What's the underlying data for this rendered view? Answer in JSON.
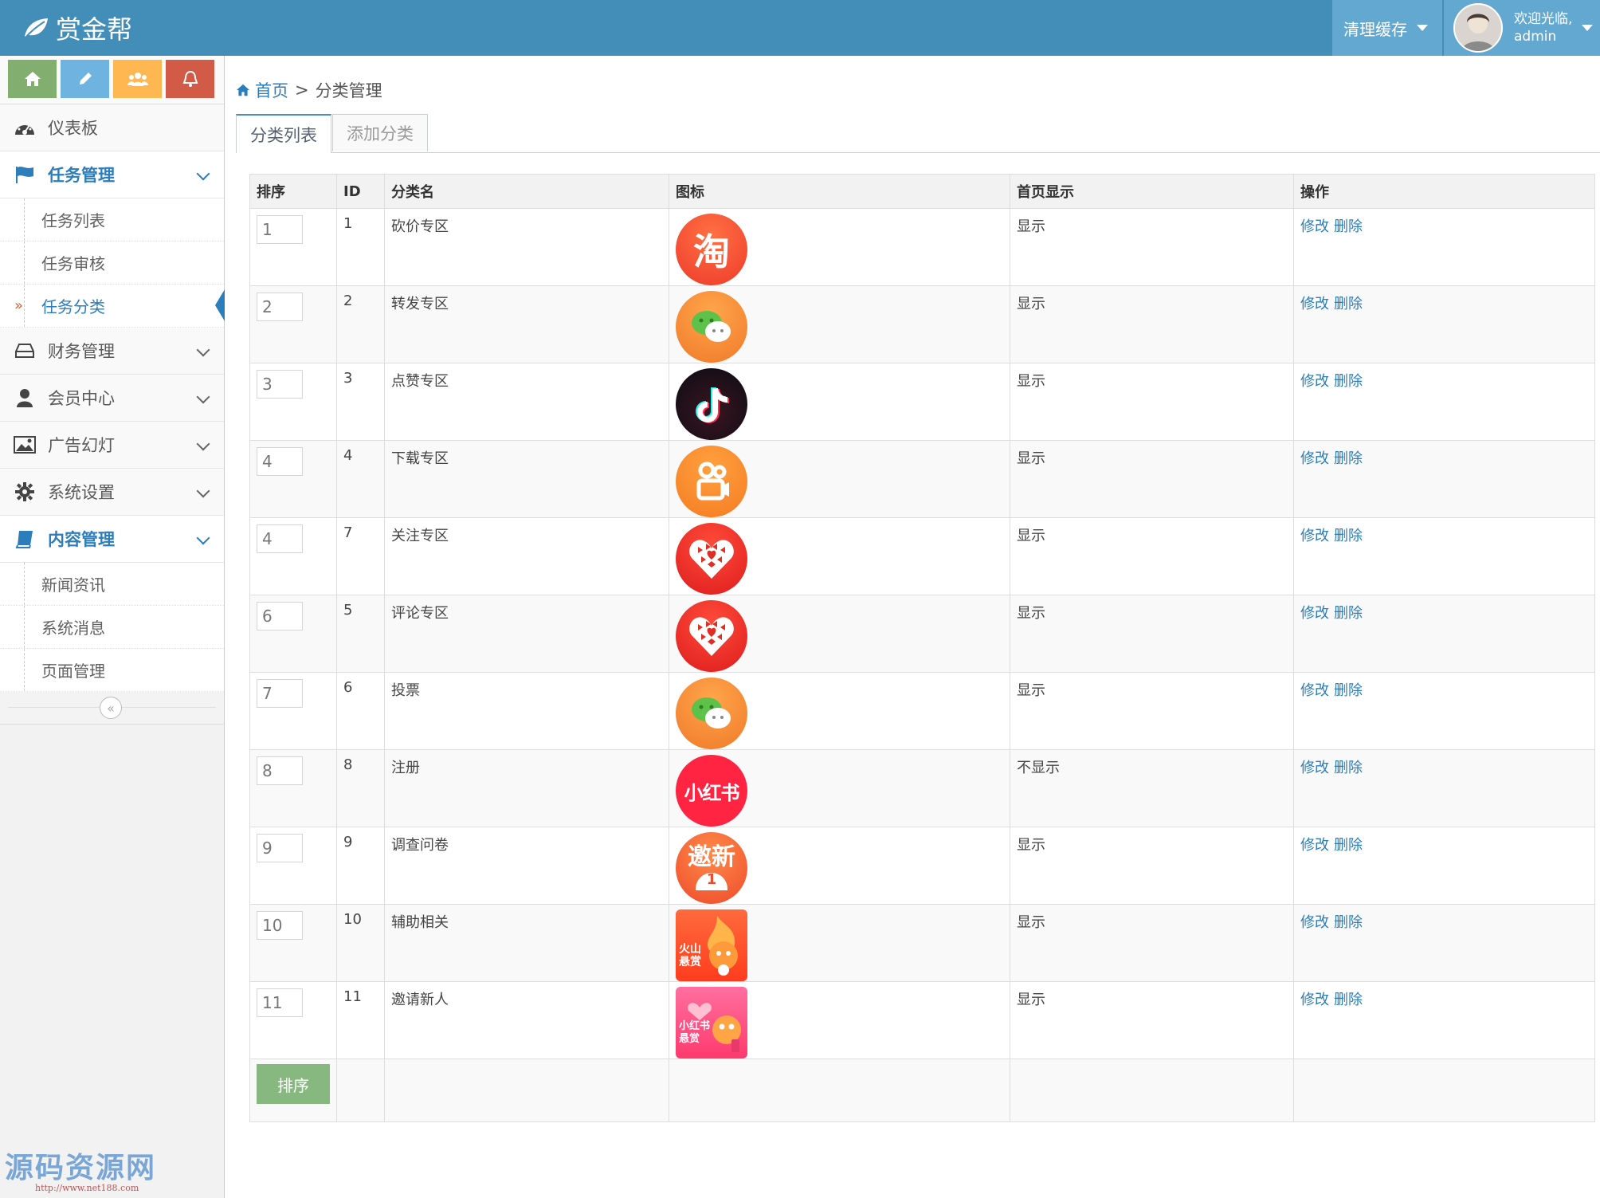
{
  "brand": {
    "name": "赏金帮"
  },
  "navbar": {
    "clear_cache": "清理缓存",
    "welcome": "欢迎光临,",
    "username": "admin"
  },
  "sidebar": {
    "shortcuts": [
      {
        "icon": "home-icon",
        "color": "#82af6f"
      },
      {
        "icon": "pencil-icon",
        "color": "#6fb3e0"
      },
      {
        "icon": "users-icon",
        "color": "#ffb752"
      },
      {
        "icon": "bell-icon",
        "color": "#d15b47"
      }
    ],
    "menu": {
      "dashboard": "仪表板",
      "task_mgmt": "任务管理",
      "task_list": "任务列表",
      "task_review": "任务审核",
      "task_category": "任务分类",
      "finance": "财务管理",
      "members": "会员中心",
      "ads": "广告幻灯",
      "settings": "系统设置",
      "content": "内容管理",
      "news": "新闻资讯",
      "messages": "系统消息",
      "pages": "页面管理"
    },
    "collapse_glyph": "«"
  },
  "breadcrumb": {
    "home": "首页",
    "separator": ">",
    "current": "分类管理"
  },
  "tabs": {
    "list": "分类列表",
    "add": "添加分类"
  },
  "table": {
    "headers": {
      "sort": "排序",
      "id": "ID",
      "name": "分类名",
      "icon": "图标",
      "home_display": "首页显示",
      "actions": "操作"
    },
    "edit_label": "修改",
    "delete_label": "删除",
    "sort_button": "排序",
    "rows": [
      {
        "sort": "1",
        "id": "1",
        "name": "砍价专区",
        "icon": "taobao-icon",
        "display": "显示"
      },
      {
        "sort": "2",
        "id": "2",
        "name": "转发专区",
        "icon": "wechat-icon",
        "display": "显示"
      },
      {
        "sort": "3",
        "id": "3",
        "name": "点赞专区",
        "icon": "douyin-icon",
        "display": "显示"
      },
      {
        "sort": "4",
        "id": "4",
        "name": "下载专区",
        "icon": "kuaishou-icon",
        "display": "显示"
      },
      {
        "sort": "4",
        "id": "7",
        "name": "关注专区",
        "icon": "pinduoduo-icon",
        "display": "显示"
      },
      {
        "sort": "6",
        "id": "5",
        "name": "评论专区",
        "icon": "pinduoduo-icon",
        "display": "显示"
      },
      {
        "sort": "7",
        "id": "6",
        "name": "投票",
        "icon": "wechat-icon",
        "display": "显示"
      },
      {
        "sort": "8",
        "id": "8",
        "name": "注册",
        "icon": "xiaohongshu-icon",
        "display": "不显示"
      },
      {
        "sort": "9",
        "id": "9",
        "name": "调查问卷",
        "icon": "invite-new-icon",
        "display": "显示"
      },
      {
        "sort": "10",
        "id": "10",
        "name": "辅助相关",
        "icon": "huoshan-reward-icon",
        "display": "显示"
      },
      {
        "sort": "11",
        "id": "11",
        "name": "邀请新人",
        "icon": "xiaohongshu-reward-icon",
        "display": "显示"
      }
    ],
    "icon_text": {
      "taobao": "淘",
      "xiaohongshu": "小红书",
      "invite": "邀新",
      "huoshan": "火山\n悬赏",
      "xhs_reward": "小红书\n悬赏"
    }
  },
  "watermark": {
    "text": "源码资源网",
    "url": "http://www.net188.com"
  },
  "colors": {
    "navbar": "#438eb9",
    "accent": "#2b7dbc",
    "sort_button": "#87b87f"
  }
}
